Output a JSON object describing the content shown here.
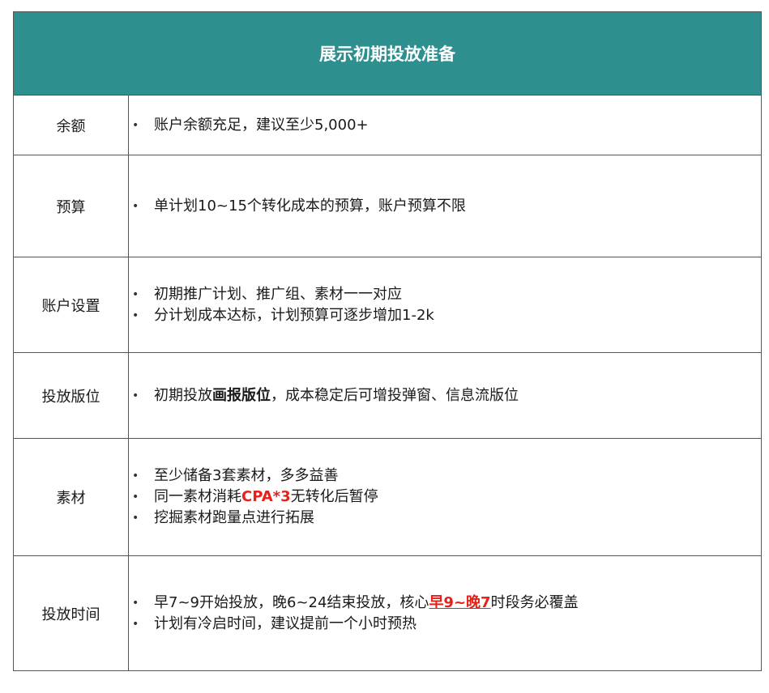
{
  "title": "展示初期投放准备",
  "rows": [
    {
      "label": "余额",
      "bullets": [
        {
          "t1": "账户余额充足，建议至少5,000+"
        }
      ]
    },
    {
      "label": "预算",
      "bullets": [
        {
          "t1": "单计划10~15个转化成本的预算，账户预算不限"
        }
      ]
    },
    {
      "label": "账户设置",
      "bullets": [
        {
          "t1": "初期推广计划、推广组、素材一一对应"
        },
        {
          "t1": "分计划成本达标，计划预算可逐步增加1-2k"
        }
      ]
    },
    {
      "label": "投放版位",
      "bullets": [
        {
          "t1": "初期投放",
          "em": "画报版位",
          "t2": "，成本稳定后可增投弹窗、信息流版位"
        }
      ]
    },
    {
      "label": "素材",
      "bullets": [
        {
          "t1": "至少储备3套素材，多多益善"
        },
        {
          "t1": "同一素材消耗",
          "em": "CPA*3",
          "t2": "无转化后暂停"
        },
        {
          "t1": "挖掘素材跑量点进行拓展"
        }
      ]
    },
    {
      "label": "投放时间",
      "bullets": [
        {
          "t1": "早7~9开始投放，晚6~24结束投放，核心",
          "em": "早9~晚7",
          "t2": "时段务必覆盖"
        },
        {
          "t1": "计划有冷启时间，建议提前一个小时预热"
        }
      ]
    }
  ],
  "colors": {
    "header_bg": "#2e8f8f",
    "emphasis_red": "#e8201a"
  }
}
